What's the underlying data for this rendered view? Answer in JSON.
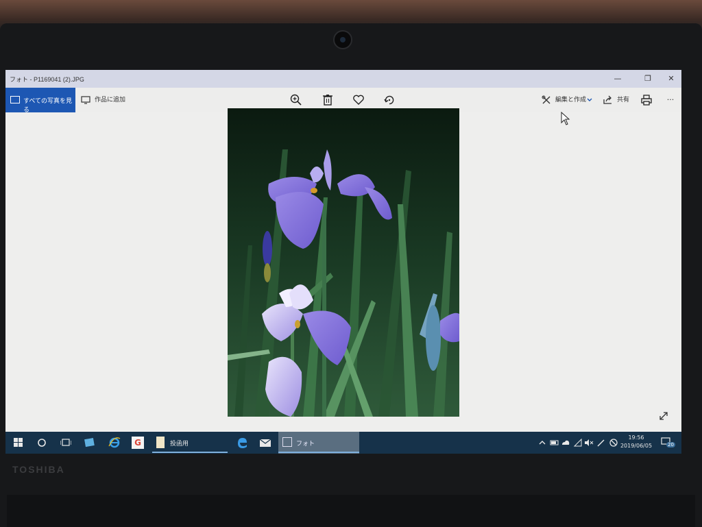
{
  "window": {
    "title": "フォト - P1169041 (2).JPG",
    "minimize": "—",
    "maximize": "❐",
    "close": "✕"
  },
  "toolbar": {
    "all_photos": "すべての写真を見る",
    "add_to_creation": "作品に追加",
    "edit_create": "編集と作成",
    "share": "共有",
    "more": "···",
    "icons": [
      "zoom-in-icon",
      "delete-icon",
      "heart-icon",
      "rotate-icon",
      "print-icon"
    ]
  },
  "photo": {
    "subject": "purple iris flowers"
  },
  "taskbar": {
    "pinned_label": "投函用",
    "active_app": "フォト",
    "time": "19:56",
    "date": "2019/06/05",
    "notification_count": "20"
  },
  "device": {
    "brand": "TOSHIBA"
  },
  "colors": {
    "accent": "#1d57b3",
    "taskbar": "#16324a",
    "titlebar": "#d4d7e6"
  }
}
